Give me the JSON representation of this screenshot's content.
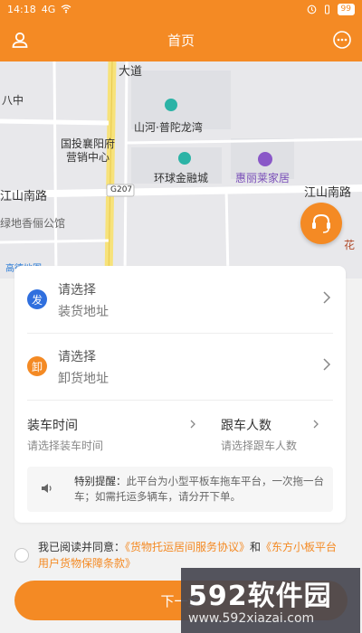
{
  "status": {
    "time": "14:18",
    "signal": "4G",
    "battery": "99"
  },
  "header": {
    "title": "首页",
    "left_icon": "user-icon",
    "right_icon": "more-icon"
  },
  "map": {
    "labels": {
      "da_dao": "大道",
      "ba_zhong": "八中",
      "shanhe": "山河·普陀龙湾",
      "guotou": "国投襄阳府",
      "yingxiao": "营销中心",
      "huanqiu": "环球金融城",
      "huili": "惠丽莱家居",
      "jiangshan_left": "江山南路",
      "jiangshan_right": "江山南路",
      "g207": "G207",
      "lvdi": "绿地香俪公馆",
      "hua": "花",
      "gaode": "高德地图"
    },
    "service_icon": "customer-service-icon"
  },
  "form": {
    "pickup": {
      "badge": "发",
      "placeholder": "请选择",
      "label": "装货地址"
    },
    "dropoff": {
      "badge": "卸",
      "placeholder": "请选择",
      "label": "卸货地址"
    },
    "load_time": {
      "title": "装车时间",
      "placeholder": "请选择装车时间"
    },
    "followers": {
      "title": "跟车人数",
      "placeholder": "请选择跟车人数"
    },
    "notice": {
      "title": "特别提醒：",
      "text": "此平台为小型平板车拖车平台，一次拖一台车；如需托运多辆车，请分开下单。"
    }
  },
  "agreement": {
    "prefix": "我已阅读并同意：",
    "link1": "《货物托运居间服务协议》",
    "and": "和",
    "link2": "《东方小板平台用户货物保障条款》"
  },
  "next_button": "下一步",
  "watermark": {
    "big": "592软件园",
    "small": "www.592xiazai.com"
  },
  "colors": {
    "accent": "#f48a24",
    "blue": "#2f6fde"
  }
}
